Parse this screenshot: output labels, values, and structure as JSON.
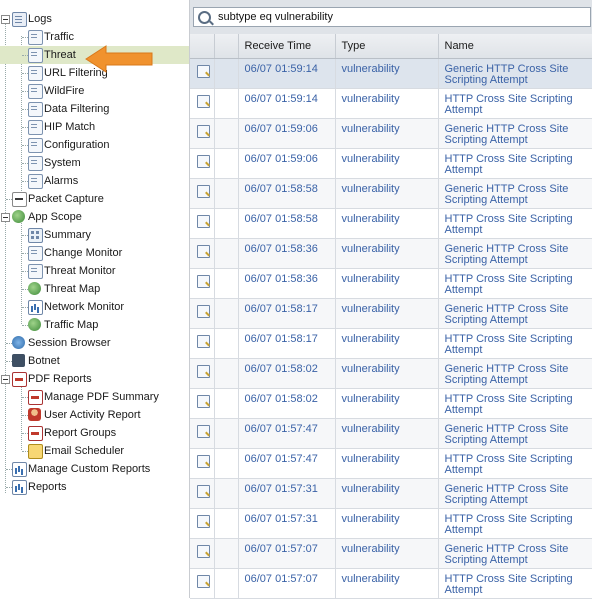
{
  "sidebar": {
    "items": [
      {
        "label": "Logs",
        "icon": "logs-icon"
      },
      {
        "label": "Traffic",
        "icon": "traffic-icon"
      },
      {
        "label": "Threat",
        "icon": "threat-icon"
      },
      {
        "label": "URL Filtering",
        "icon": "url-filtering-icon"
      },
      {
        "label": "WildFire",
        "icon": "wildfire-icon"
      },
      {
        "label": "Data Filtering",
        "icon": "data-filtering-icon"
      },
      {
        "label": "HIP Match",
        "icon": "hip-match-icon"
      },
      {
        "label": "Configuration",
        "icon": "configuration-icon"
      },
      {
        "label": "System",
        "icon": "system-icon"
      },
      {
        "label": "Alarms",
        "icon": "alarms-icon"
      },
      {
        "label": "Packet Capture",
        "icon": "packet-capture-icon"
      },
      {
        "label": "App Scope",
        "icon": "app-scope-icon"
      },
      {
        "label": "Summary",
        "icon": "summary-icon"
      },
      {
        "label": "Change Monitor",
        "icon": "change-monitor-icon"
      },
      {
        "label": "Threat Monitor",
        "icon": "threat-monitor-icon"
      },
      {
        "label": "Threat Map",
        "icon": "threat-map-icon"
      },
      {
        "label": "Network Monitor",
        "icon": "network-monitor-icon"
      },
      {
        "label": "Traffic Map",
        "icon": "traffic-map-icon"
      },
      {
        "label": "Session Browser",
        "icon": "session-browser-icon"
      },
      {
        "label": "Botnet",
        "icon": "botnet-icon"
      },
      {
        "label": "PDF Reports",
        "icon": "pdf-reports-icon"
      },
      {
        "label": "Manage PDF Summary",
        "icon": "pdf-summary-icon"
      },
      {
        "label": "User Activity Report",
        "icon": "user-activity-icon"
      },
      {
        "label": "Report Groups",
        "icon": "report-groups-icon"
      },
      {
        "label": "Email Scheduler",
        "icon": "email-scheduler-icon"
      },
      {
        "label": "Manage Custom Reports",
        "icon": "custom-reports-icon"
      },
      {
        "label": "Reports",
        "icon": "reports-icon"
      }
    ],
    "selected": "Threat"
  },
  "search": {
    "value": "subtype eq vulnerability"
  },
  "table": {
    "columns": [
      "Receive Time",
      "Type",
      "Name"
    ],
    "rows": [
      {
        "time": "06/07 01:59:14",
        "type": "vulnerability",
        "name": "Generic HTTP Cross Site Scripting Attempt"
      },
      {
        "time": "06/07 01:59:14",
        "type": "vulnerability",
        "name": "HTTP Cross Site Scripting Attempt"
      },
      {
        "time": "06/07 01:59:06",
        "type": "vulnerability",
        "name": "Generic HTTP Cross Site Scripting Attempt"
      },
      {
        "time": "06/07 01:59:06",
        "type": "vulnerability",
        "name": "HTTP Cross Site Scripting Attempt"
      },
      {
        "time": "06/07 01:58:58",
        "type": "vulnerability",
        "name": "Generic HTTP Cross Site Scripting Attempt"
      },
      {
        "time": "06/07 01:58:58",
        "type": "vulnerability",
        "name": "HTTP Cross Site Scripting Attempt"
      },
      {
        "time": "06/07 01:58:36",
        "type": "vulnerability",
        "name": "Generic HTTP Cross Site Scripting Attempt"
      },
      {
        "time": "06/07 01:58:36",
        "type": "vulnerability",
        "name": "HTTP Cross Site Scripting Attempt"
      },
      {
        "time": "06/07 01:58:17",
        "type": "vulnerability",
        "name": "Generic HTTP Cross Site Scripting Attempt"
      },
      {
        "time": "06/07 01:58:17",
        "type": "vulnerability",
        "name": "HTTP Cross Site Scripting Attempt"
      },
      {
        "time": "06/07 01:58:02",
        "type": "vulnerability",
        "name": "Generic HTTP Cross Site Scripting Attempt"
      },
      {
        "time": "06/07 01:58:02",
        "type": "vulnerability",
        "name": "HTTP Cross Site Scripting Attempt"
      },
      {
        "time": "06/07 01:57:47",
        "type": "vulnerability",
        "name": "Generic HTTP Cross Site Scripting Attempt"
      },
      {
        "time": "06/07 01:57:47",
        "type": "vulnerability",
        "name": "HTTP Cross Site Scripting Attempt"
      },
      {
        "time": "06/07 01:57:31",
        "type": "vulnerability",
        "name": "Generic HTTP Cross Site Scripting Attempt"
      },
      {
        "time": "06/07 01:57:31",
        "type": "vulnerability",
        "name": "HTTP Cross Site Scripting Attempt"
      },
      {
        "time": "06/07 01:57:07",
        "type": "vulnerability",
        "name": "Generic HTTP Cross Site Scripting Attempt"
      },
      {
        "time": "06/07 01:57:07",
        "type": "vulnerability",
        "name": "HTTP Cross Site Scripting Attempt"
      }
    ]
  },
  "colors": {
    "link": "#3a62a7",
    "selected_row": "#dfe8c8",
    "arrow": "#f0922e"
  }
}
